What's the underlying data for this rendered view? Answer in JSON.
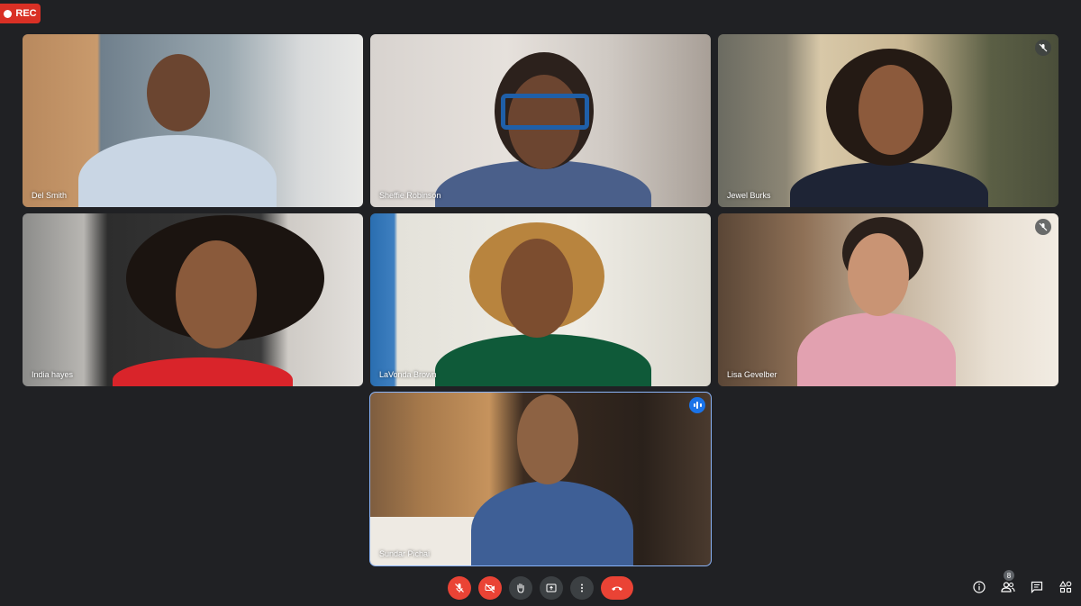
{
  "recording": {
    "label": "REC"
  },
  "participants": [
    {
      "name": "Del Smith",
      "mic_muted": false,
      "speaking": false
    },
    {
      "name": "Sheffie Robinson",
      "mic_muted": false,
      "speaking": false
    },
    {
      "name": "Jewel Burks",
      "mic_muted": true,
      "speaking": false
    },
    {
      "name": "India hayes",
      "mic_muted": false,
      "speaking": false
    },
    {
      "name": "LaVonda Brown",
      "mic_muted": false,
      "speaking": false
    },
    {
      "name": "Lisa Gevelber",
      "mic_muted": true,
      "speaking": false
    },
    {
      "name": "Sundar Pichai",
      "mic_muted": false,
      "speaking": true
    }
  ],
  "controls": {
    "items": [
      {
        "icon": "mic-off-icon"
      },
      {
        "icon": "camera-off-icon"
      },
      {
        "icon": "raise-hand-icon"
      },
      {
        "icon": "present-screen-icon"
      },
      {
        "icon": "more-options-icon"
      },
      {
        "icon": "hang-up-icon"
      }
    ]
  },
  "side_panel": {
    "participants_count": "8",
    "icons": [
      "info-icon",
      "people-icon",
      "chat-icon",
      "activities-icon"
    ]
  },
  "colors": {
    "background": "#202124",
    "danger": "#ea4335",
    "accent": "#8ab4f8"
  }
}
